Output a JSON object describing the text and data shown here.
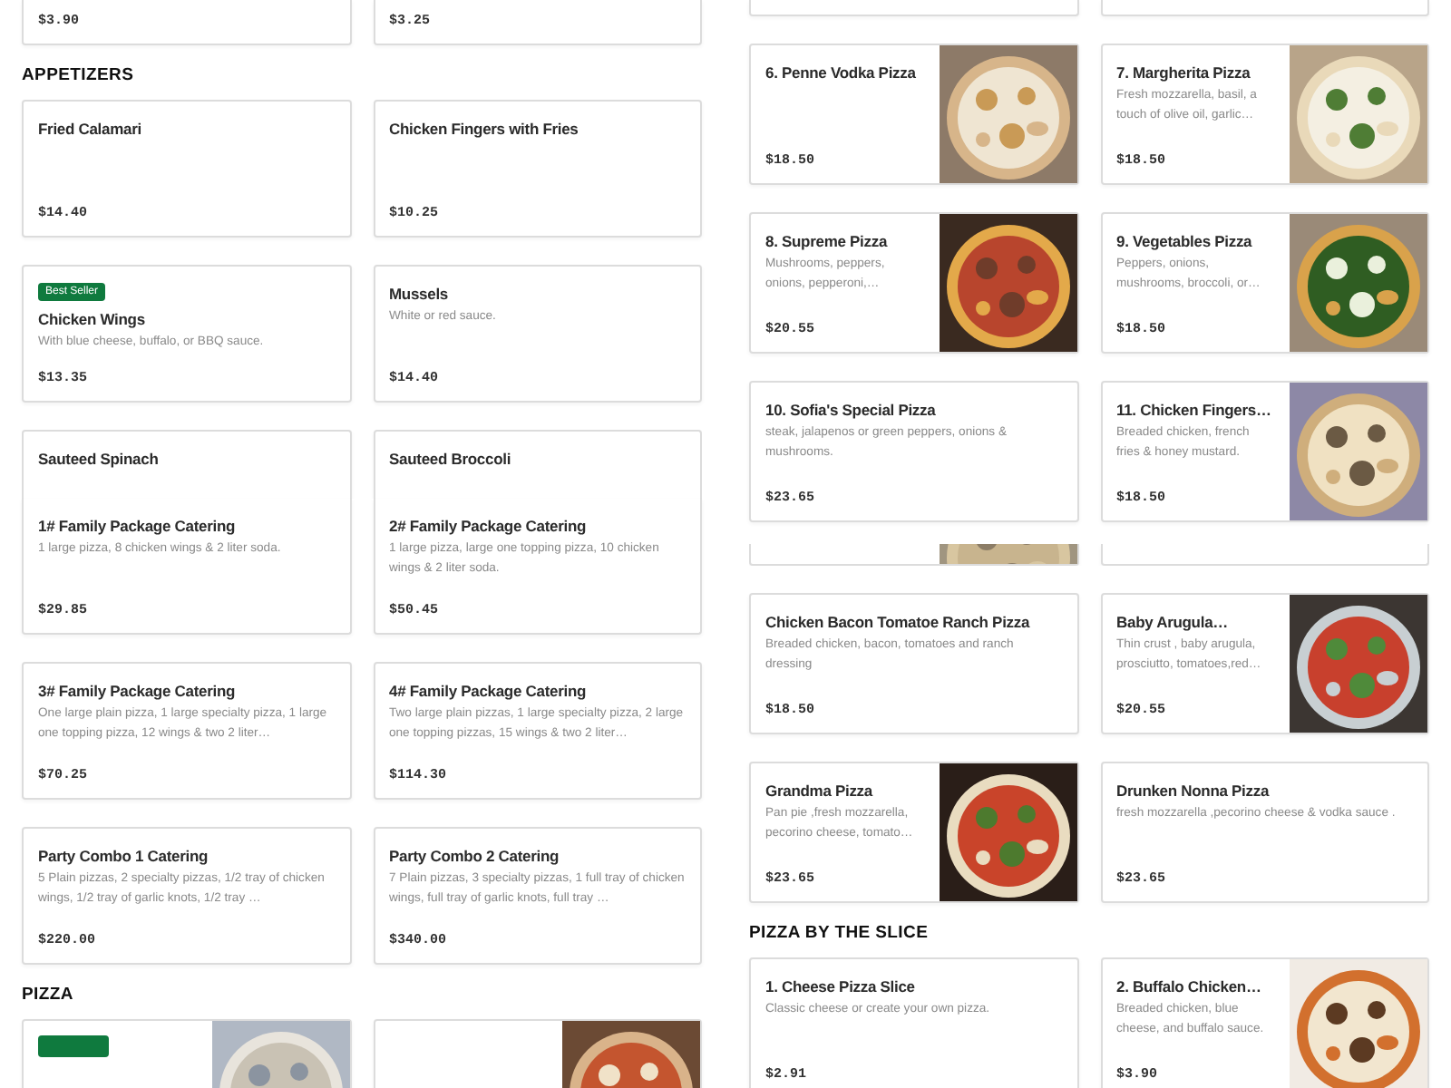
{
  "columns": [
    {
      "blocks": [
        {
          "kind": "row_top_cut",
          "cards": [
            {
              "kind": "plain",
              "price": "$3.90"
            },
            {
              "kind": "plain",
              "price": "$3.25"
            }
          ]
        },
        {
          "kind": "heading",
          "text": "APPETIZERS"
        },
        {
          "kind": "row",
          "cards": [
            {
              "kind": "plain",
              "name": "Fried Calamari",
              "price": "$14.40"
            },
            {
              "kind": "plain",
              "name": "Chicken Fingers with Fries",
              "price": "$10.25"
            }
          ]
        },
        {
          "kind": "row",
          "cards": [
            {
              "kind": "plain",
              "badge": "Best Seller",
              "name": "Chicken Wings",
              "description": "With blue cheese, buffalo, or BBQ sauce.",
              "price": "$13.35"
            },
            {
              "kind": "plain",
              "name": "Mussels",
              "description": "White or red sauce.",
              "price": "$14.40"
            }
          ]
        },
        {
          "kind": "row_bottom_cut",
          "cards": [
            {
              "kind": "plain",
              "name": "Sauteed Spinach"
            },
            {
              "kind": "plain",
              "name": "Sauteed Broccoli"
            }
          ]
        },
        {
          "kind": "row",
          "cards": [
            {
              "kind": "plain",
              "name": "1# Family Package Catering",
              "description": "1 large pizza, 8 chicken wings & 2 liter soda.",
              "price": "$29.85"
            },
            {
              "kind": "plain",
              "name": "2# Family Package Catering",
              "description": "1 large pizza, large one topping pizza, 10 chicken wings & 2 liter soda.",
              "price": "$50.45"
            }
          ]
        },
        {
          "kind": "row",
          "cards": [
            {
              "kind": "plain",
              "name": "3# Family Package Catering",
              "description": "One large plain pizza, 1 large specialty pizza, 1 large one topping pizza, 12 wings & two 2 liter…",
              "price": "$70.25"
            },
            {
              "kind": "plain",
              "name": "4# Family Package Catering",
              "description": "Two large plain pizzas, 1 large specialty pizza, 2 large one topping pizzas, 15 wings & two 2 liter…",
              "price": "$114.30"
            }
          ]
        },
        {
          "kind": "row",
          "cards": [
            {
              "kind": "plain",
              "name": "Party Combo 1 Catering",
              "description": "5 Plain pizzas, 2 specialty pizzas, 1/2 tray of chicken wings, 1/2 tray of garlic knots, 1/2 tray …",
              "price": "$220.00"
            },
            {
              "kind": "plain",
              "name": "Party Combo 2 Catering",
              "description": "7 Plain pizzas, 3 specialty pizzas, 1 full tray of chicken wings, full tray of garlic knots, full tray …",
              "price": "$340.00"
            }
          ]
        },
        {
          "kind": "heading",
          "text": "PIZZA"
        },
        {
          "kind": "row",
          "cards": [
            {
              "kind": "picture",
              "best_seller": true
            },
            {
              "kind": "picture"
            }
          ]
        }
      ]
    },
    {
      "blocks": [
        {
          "kind": "row_top_cut",
          "cards": [
            {
              "kind": "plain"
            },
            {
              "kind": "plain"
            }
          ]
        },
        {
          "kind": "row",
          "cards": [
            {
              "kind": "picture",
              "name": "6. Penne Vodka Pizza",
              "price": "$18.50"
            },
            {
              "kind": "picture",
              "name": "7. Margherita Pizza",
              "description": "Fresh mozzarella, basil, a touch of olive oil, garlic…",
              "price": "$18.50"
            }
          ]
        },
        {
          "kind": "row",
          "cards": [
            {
              "kind": "picture",
              "name": "8. Supreme Pizza",
              "description": "Mushrooms, peppers, onions, pepperoni,…",
              "price": "$20.55"
            },
            {
              "kind": "picture",
              "name": "9. Vegetables Pizza",
              "description": "Peppers, onions, mushrooms, broccoli, or…",
              "price": "$18.50"
            }
          ]
        },
        {
          "kind": "row",
          "cards": [
            {
              "kind": "plain",
              "name": "10. Sofia's Special Pizza",
              "description": "steak, jalapenos or green peppers, onions & mushrooms.",
              "price": "$23.65"
            },
            {
              "kind": "picture",
              "name": "11. Chicken Fingers…",
              "description": "Breaded chicken, french fries & honey mustard.",
              "price": "$18.50"
            }
          ]
        },
        {
          "kind": "row_strip",
          "cards": [
            {
              "kind": "picture"
            },
            {
              "kind": "plain"
            }
          ]
        },
        {
          "kind": "row",
          "cards": [
            {
              "kind": "plain",
              "name": "Chicken Bacon Tomatoe Ranch Pizza",
              "description": "Breaded chicken, bacon, tomatoes and ranch dressing",
              "price": "$18.50"
            },
            {
              "kind": "picture",
              "name": "Baby Arugula…",
              "description": "Thin crust , baby arugula, prosciutto, tomatoes,red…",
              "price": "$20.55"
            }
          ]
        },
        {
          "kind": "row",
          "cards": [
            {
              "kind": "picture",
              "name": "Grandma Pizza",
              "description": "Pan pie ,fresh mozzarella, pecorino cheese, tomato…",
              "price": "$23.65"
            },
            {
              "kind": "plain",
              "name": "Drunken Nonna Pizza",
              "description": "fresh mozzarella ,pecorino cheese & vodka sauce .",
              "price": "$23.65"
            }
          ]
        },
        {
          "kind": "heading",
          "text": "PIZZA BY THE SLICE"
        },
        {
          "kind": "row",
          "cards": [
            {
              "kind": "plain",
              "name": "1. Cheese Pizza Slice",
              "description": "Classic cheese or create your own pizza.",
              "price": "$2.91"
            },
            {
              "kind": "picture",
              "name": "2. Buffalo Chicken…",
              "description": "Breaded chicken, blue cheese, and buffalo sauce.",
              "price": "$3.90"
            }
          ]
        }
      ]
    }
  ]
}
